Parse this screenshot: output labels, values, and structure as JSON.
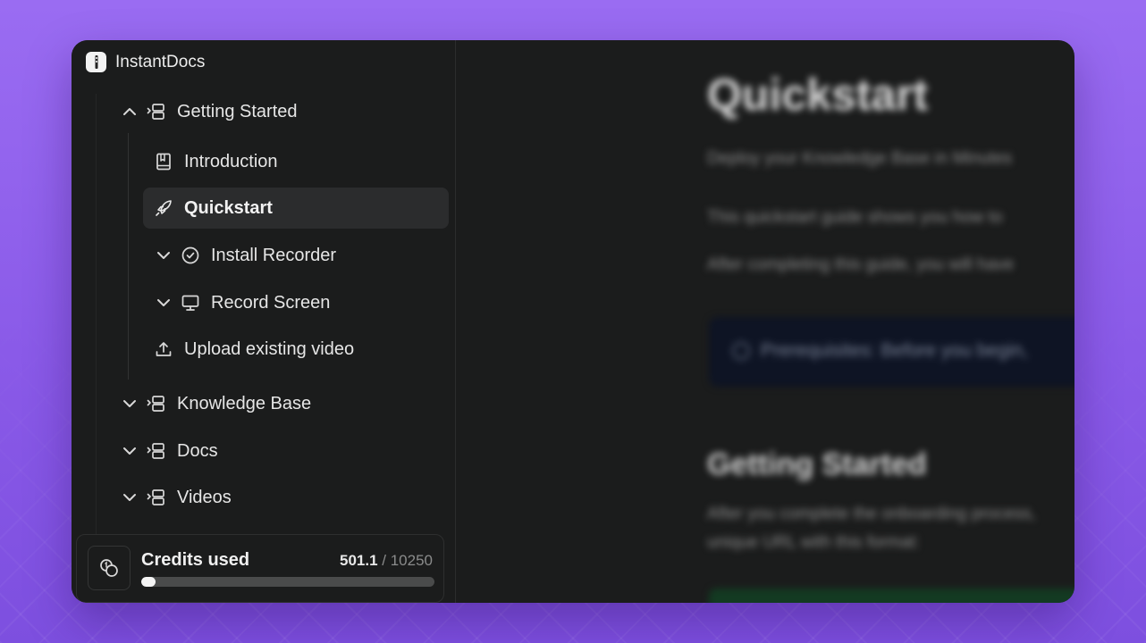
{
  "app": {
    "title": "InstantDocs"
  },
  "sidebar": {
    "items": [
      {
        "label": "Getting Started",
        "icon": "folder-tree-icon",
        "chevron": "chevron-up-icon"
      },
      {
        "label": "Introduction",
        "icon": "book-icon"
      },
      {
        "label": "Quickstart",
        "icon": "rocket-icon",
        "active": true
      },
      {
        "label": "Install Recorder",
        "icon": "check-circle-icon",
        "chevron": "chevron-down-icon"
      },
      {
        "label": "Record Screen",
        "icon": "monitor-icon",
        "chevron": "chevron-down-icon"
      },
      {
        "label": "Upload existing video",
        "icon": "upload-icon"
      },
      {
        "label": "Knowledge Base",
        "icon": "folder-tree-icon",
        "chevron": "chevron-down-icon"
      },
      {
        "label": "Docs",
        "icon": "folder-tree-icon",
        "chevron": "chevron-down-icon"
      },
      {
        "label": "Videos",
        "icon": "folder-tree-icon",
        "chevron": "chevron-down-icon"
      }
    ]
  },
  "credits": {
    "label": "Credits used",
    "used": "501.1",
    "separator": " / ",
    "total": "10250",
    "fraction": 0.0489
  },
  "content": {
    "title": "Quickstart",
    "subtitle": "Deploy your Knowledge Base in Minutes",
    "para1": "This quickstart guide shows you how to",
    "para2": "After completing this guide, you will have",
    "callout": "Prerequisites: Before you begin,",
    "h2": "Getting Started",
    "para3_line1": "After you complete the onboarding process,",
    "para3_line2": "unique URL with this format:"
  },
  "colors": {
    "background_top": "#9a6cf2",
    "window": "#1b1c1c",
    "active_item": "#2b2c2d",
    "text": "#e6e6e6",
    "progress_fill": "#f4f4f4",
    "progress_track": "#4a4b4b"
  }
}
